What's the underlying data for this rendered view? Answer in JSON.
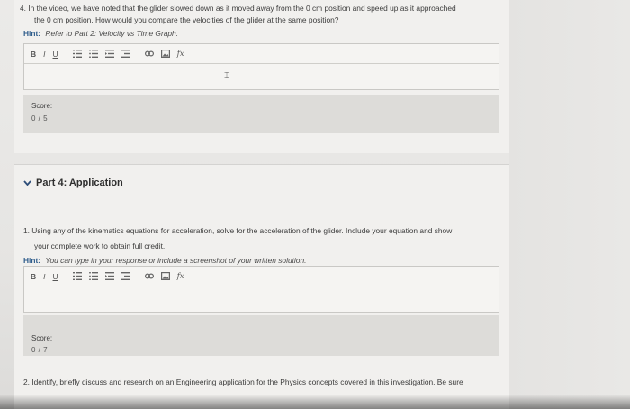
{
  "question4": {
    "line1": "4. In the video, we have noted that the glider slowed down as it moved away from the 0 cm position and speed up as it approached",
    "line2": "the 0 cm position. How would you compare the velocities of the glider at the same position?",
    "hint_label": "Hint:",
    "hint_text": "Refer to Part 2: Velocity vs Time Graph.",
    "score_label": "Score:",
    "score_value": "0 / 5"
  },
  "toolbar": {
    "bold": "B",
    "italic": "I",
    "underline": "U",
    "formula": "fx"
  },
  "part4": {
    "title": "Part 4: Application",
    "q1_line1": "1. Using any of the kinematics equations for acceleration, solve for the acceleration of the glider. Include your equation and show",
    "q1_line2": "your complete work to obtain full credit.",
    "hint_label": "Hint:",
    "hint_text": "You can type in your response or include a screenshot of your written solution.",
    "score_label": "Score:",
    "score_value": "0 / 7",
    "q2_line1": "2. Identify, briefly discuss and research on an Engineering application for the Physics concepts covered in this investigation. Be sure"
  }
}
